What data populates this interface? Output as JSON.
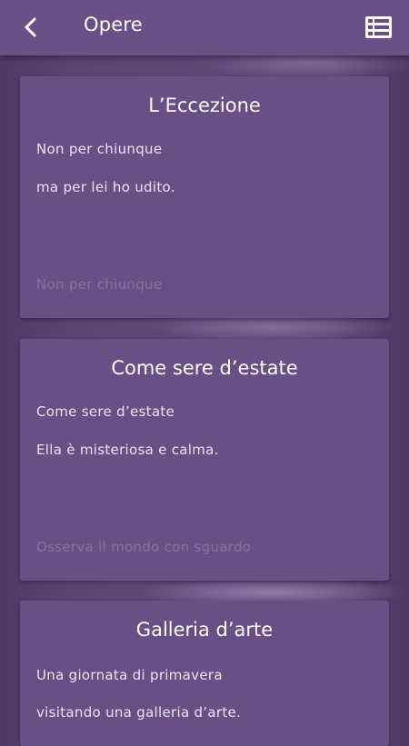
{
  "app_bar": {
    "title": "Opere",
    "back_icon": "chevron-left-icon",
    "list_icon": "list-view-icon",
    "color": "#6b4f87"
  },
  "cards": [
    {
      "title": "L’Eccezione",
      "lines": [
        "Non per chiunque",
        "ma per lei ho udito."
      ],
      "faded_line": "Non per chiunque"
    },
    {
      "title": "Come sere d’estate",
      "lines": [
        "Come sere d’estate",
        "Ella è misteriosa e calma."
      ],
      "faded_line": "Osserva il mondo con sguardo"
    },
    {
      "title": "Galleria d’arte",
      "lines": [
        "Una giornata di primavera",
        "visitando una galleria d’arte."
      ],
      "faded_line": ""
    }
  ]
}
